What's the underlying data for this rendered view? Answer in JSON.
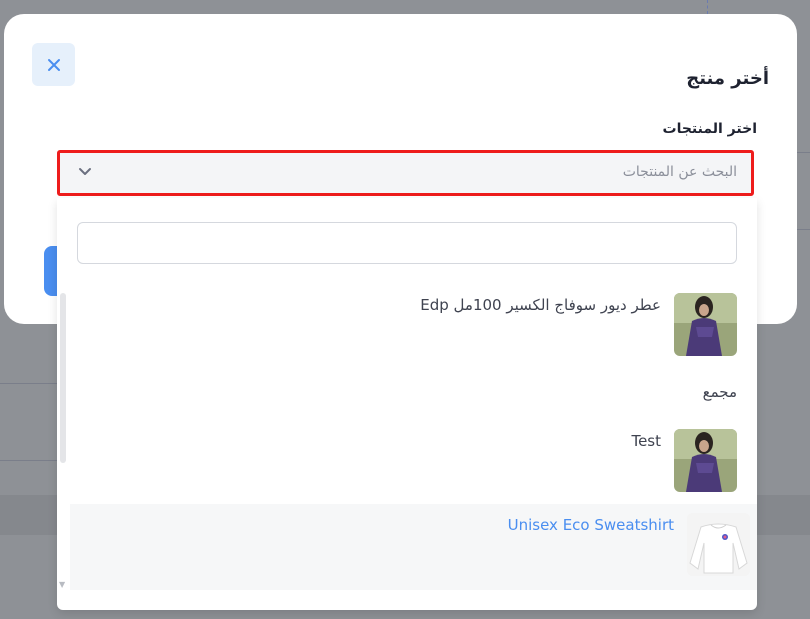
{
  "modal": {
    "title": "أختر منتج",
    "close_icon": "close-icon"
  },
  "field": {
    "label": "اختر المنتجات",
    "placeholder": "البحث عن المنتجات",
    "chevron_icon": "chevron-down-icon"
  },
  "dropdown": {
    "search_value": "",
    "options": [
      {
        "label": "عطر ديور سوفاج الكسير 100مل Edp",
        "image": "dress-model-photo"
      },
      {
        "group": "مجمع"
      },
      {
        "label": "Test",
        "image": "dress-model-photo"
      },
      {
        "label": "Unisex Eco Sweatshirt",
        "image": "white-sweatshirt-photo",
        "highlighted": true
      }
    ]
  },
  "colors": {
    "accent": "#4a8ef0",
    "error_border": "#ee1c1c",
    "overlay": "#8f9297"
  }
}
